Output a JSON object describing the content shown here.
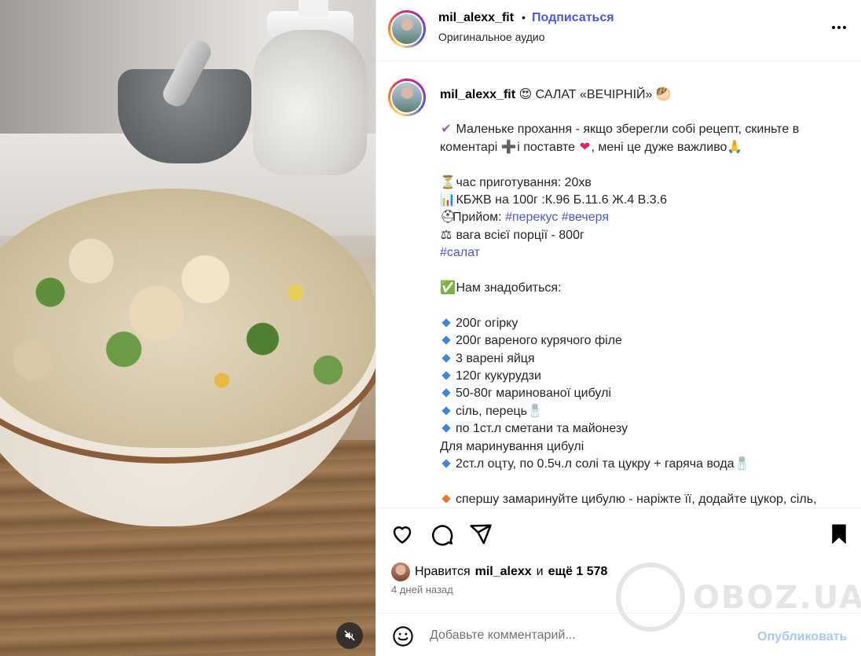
{
  "header": {
    "username": "mil_alexx_fit",
    "separator": "•",
    "follow_label": "Подписаться",
    "audio_label": "Оригинальное аудио",
    "more_icon": "more-horizontal-icon"
  },
  "caption": {
    "username": "mil_alexx_fit",
    "title_emoji": "😍",
    "title": "САЛАТ «ВЕЧІРНІЙ»",
    "title_emoji_end": "🥙",
    "request_icon": "✔",
    "request_line1": "Маленьке прохання - якщо зберегли собі рецепт, скиньте в",
    "request_line2a": "коментарі",
    "plus_icon": "➕",
    "request_line2b": "і поставте",
    "heart_icon": "❤",
    "request_line2c": ", мені це дуже важливо",
    "pray_icon": "🙏",
    "hourglass_icon": "⏳",
    "time_line": "час приготування: 20хв",
    "chart_icon": "📊",
    "kbzhv_line": "КБЖВ на 100г :К.96 Б.11.6 Ж.4 В.3.6",
    "hat_icon": "⛑",
    "meal_label": "Прийом: ",
    "tag1": "#перекус",
    "tag2": "#вечеря",
    "scale_icon": "⚖",
    "weight_line": "вага всієї порції - 800г",
    "tag3": "#салат",
    "check_icon": "✅",
    "need_line": "Нам знадобиться:",
    "ingredients": [
      "200г огірку",
      "200г вареного курячого філе",
      "3 варені яйця",
      "120г кукурудзи",
      "50-80г маринованої цибулі",
      "сіль, перець",
      "по 1ст.л сметани та майонезу"
    ],
    "salt_icon": "🧂",
    "marinade_title": "Для маринування цибулі",
    "marinade_line": "2ст.л оцту, по 0.5ч.л солі та цукру + гаряча вода",
    "step_line": "спершу замаринуйте цибулю - наріжте її, додайте цукор, сіль,"
  },
  "actions": {
    "like_icon": "heart-icon",
    "comment_icon": "comment-icon",
    "share_icon": "share-icon",
    "save_icon": "bookmark-icon"
  },
  "likes": {
    "prefix": "Нравится",
    "user": "mil_alexx",
    "middle": "и",
    "more": "ещё 1 578"
  },
  "time_ago": "4 дней назад",
  "comment": {
    "placeholder": "Добавьте комментарий...",
    "publish_label": "Опубликовать"
  },
  "watermark": "OBOZ.UA",
  "colors": {
    "accent": "#4759d6",
    "publish_disabled": "#a8c7fa",
    "muted": "#737373"
  }
}
